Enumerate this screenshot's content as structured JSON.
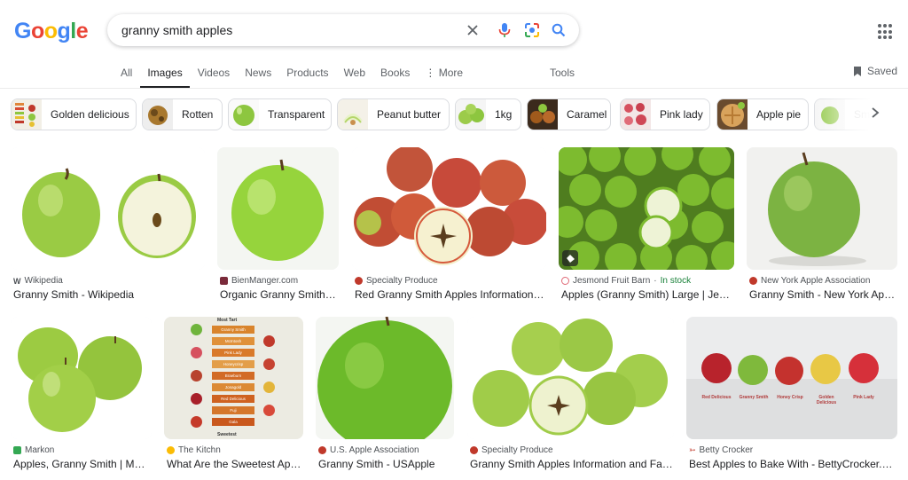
{
  "logo": {
    "g1": "G",
    "o1": "o",
    "o2": "o",
    "g2": "g",
    "l": "l",
    "e": "e"
  },
  "search": {
    "query": "granny smith apples"
  },
  "tabs": [
    "All",
    "Images",
    "Videos",
    "News",
    "Products",
    "Web",
    "Books",
    "⋮ More"
  ],
  "tools_label": "Tools",
  "saved_label": "Saved",
  "chips": [
    {
      "label": "Golden delicious",
      "thumb": "color-chart"
    },
    {
      "label": "Rotten",
      "thumb": "apple"
    },
    {
      "label": "Transparent",
      "thumb": "green-apple"
    },
    {
      "label": "Peanut butter",
      "thumb": "slices"
    },
    {
      "label": "1kg",
      "thumb": "green-apples"
    },
    {
      "label": "Caramel",
      "thumb": "caramel-apples"
    },
    {
      "label": "Pink lady",
      "thumb": "red-apples"
    },
    {
      "label": "Apple pie",
      "thumb": "pie"
    },
    {
      "label": "Sm",
      "thumb": "green-apple"
    }
  ],
  "results": [
    {
      "source": "Wikipedia",
      "title": "Granny Smith - Wikipedia",
      "favicon": "W"
    },
    {
      "source": "BienManger.com",
      "title": "Organic Granny Smith a…",
      "favicon": ""
    },
    {
      "source": "Specialty Produce",
      "title": "Red Granny Smith Apples Information a…",
      "favicon": ""
    },
    {
      "source": "Jesmond Fruit Barn",
      "stock": "In stock",
      "title": "Apples (Granny Smith) Large | Jesm…",
      "favicon": ""
    },
    {
      "source": "New York Apple Association",
      "title": "Granny Smith - New York Appl…",
      "favicon": ""
    },
    {
      "source": "Markon",
      "title": "Apples, Granny Smith | MA…",
      "favicon": ""
    },
    {
      "source": "The Kitchn",
      "title": "What Are the Sweetest Appl…",
      "favicon": ""
    },
    {
      "source": "U.S. Apple Association",
      "title": "Granny Smith - USApple",
      "favicon": ""
    },
    {
      "source": "Specialty Produce",
      "title": "Granny Smith Apples Information and Facts",
      "favicon": ""
    },
    {
      "source": "Betty Crocker",
      "title": "Best Apples to Bake With - BettyCrocker.com",
      "favicon": ""
    }
  ],
  "infographic": {
    "title": "Most Tart",
    "bottom": "Sweetest",
    "rows": [
      "Granny Smith",
      "McIntosh",
      "Pink Lady",
      "Honeycrisp",
      "Braeburn",
      "Jonagold",
      "Red Delicious",
      "Fuji",
      "Gala"
    ]
  },
  "bc_labels": [
    "Red Delicious",
    "Granny Smith",
    "Honey Crisp",
    "Golden Delicious",
    "Pink Lady"
  ],
  "colors": {
    "google_blue": "#4285f4",
    "google_red": "#ea4335",
    "google_yellow": "#fbbc05",
    "google_green": "#34a853",
    "apple_green": "#8dc63f",
    "apple_red": "#c0392b"
  }
}
